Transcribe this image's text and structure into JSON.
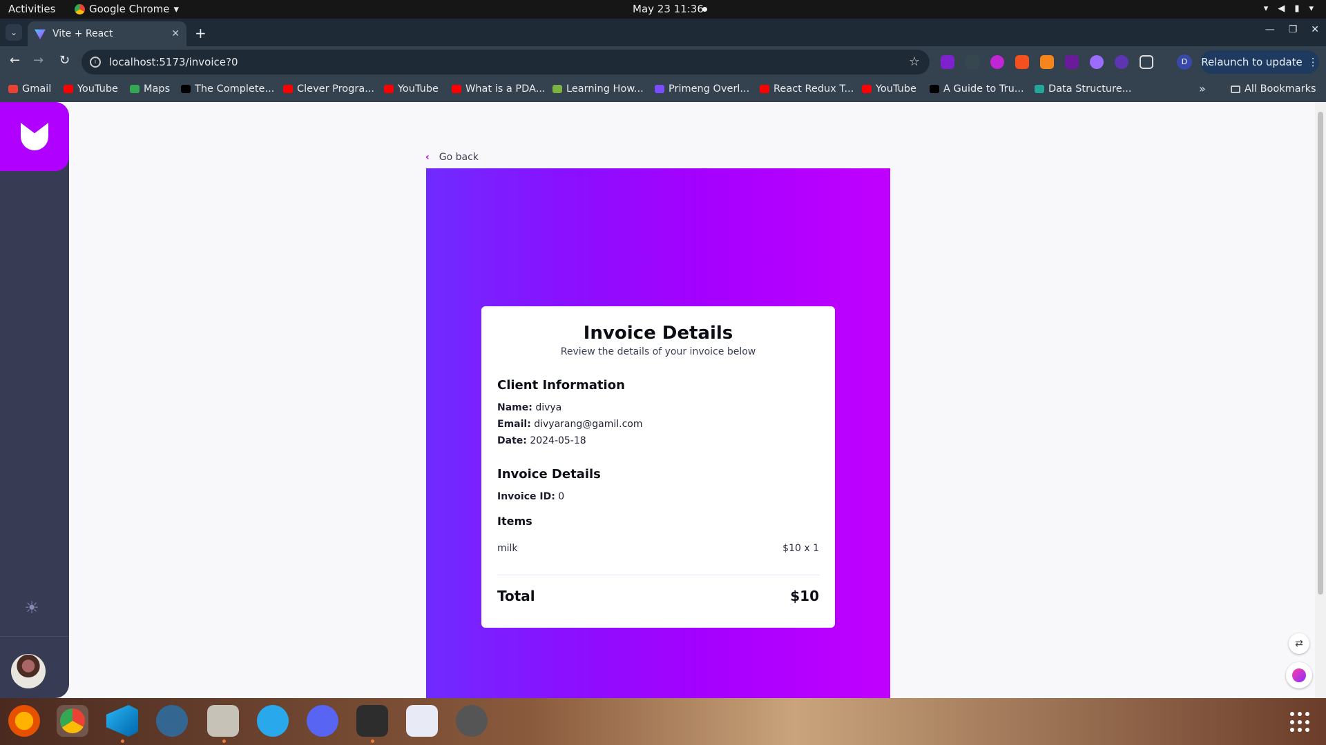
{
  "topbar": {
    "activities": "Activities",
    "app_name": "Google Chrome",
    "clock": "May 23  11:36"
  },
  "browser": {
    "tab_title": "Vite + React",
    "url": "localhost:5173/invoice?0",
    "relaunch_label": "Relaunch to update",
    "profile_initial": "D",
    "bookmarks": [
      {
        "label": "Gmail",
        "color": "#ea4335"
      },
      {
        "label": "YouTube",
        "color": "#ff0000"
      },
      {
        "label": "Maps",
        "color": "#34a853"
      },
      {
        "label": "The Complete...",
        "color": "#000000"
      },
      {
        "label": "Clever Progra...",
        "color": "#ff0000"
      },
      {
        "label": "YouTube",
        "color": "#ff0000"
      },
      {
        "label": "What is a PDA...",
        "color": "#ff0000"
      },
      {
        "label": "Learning How...",
        "color": "#7cb342"
      },
      {
        "label": "Primeng Overl...",
        "color": "#7c4dff"
      },
      {
        "label": "React Redux T...",
        "color": "#ff0000"
      },
      {
        "label": "YouTube",
        "color": "#ff0000"
      },
      {
        "label": "A Guide to Tru...",
        "color": "#000000"
      },
      {
        "label": "Data Structure...",
        "color": "#26a69a"
      }
    ],
    "all_bookmarks": "All Bookmarks"
  },
  "page": {
    "go_back": "Go back",
    "invoice": {
      "title": "Invoice Details",
      "subtitle": "Review the details of your invoice below",
      "client_heading": "Client Information",
      "name_label": "Name:",
      "name_value": "divya",
      "email_label": "Email:",
      "email_value": "divyarang@gamil.com",
      "date_label": "Date:",
      "date_value": "2024-05-18",
      "details_heading": "Invoice Details",
      "id_label": "Invoice ID:",
      "id_value": "0",
      "items_heading": "Items",
      "items": [
        {
          "name": "milk",
          "price_qty": "$10 x 1"
        }
      ],
      "total_label": "Total",
      "total_value": "$10"
    }
  },
  "colors": {
    "accent": "#b000ff",
    "sidebar": "#373b53",
    "hero_start": "#6f2bff",
    "hero_end": "#c100ff"
  }
}
